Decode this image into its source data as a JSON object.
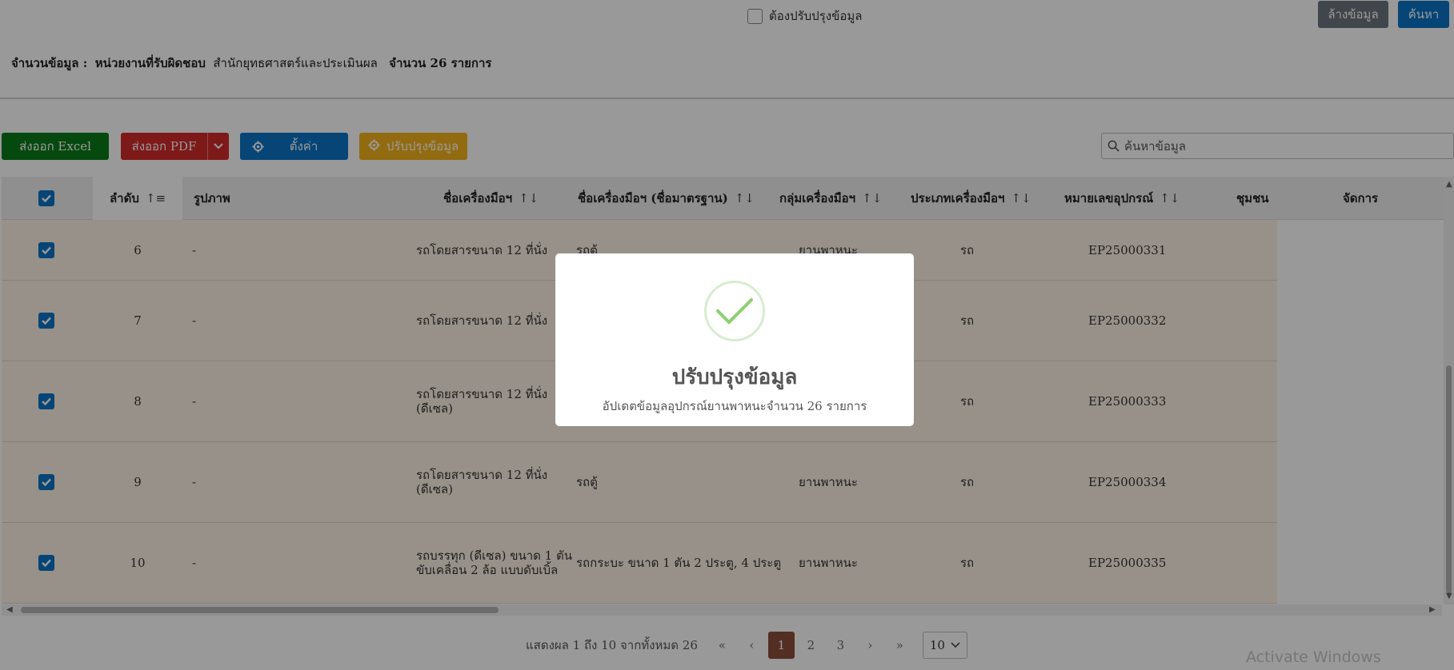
{
  "top": {
    "need_update_label": "ต้องปรับปรุงข้อมูล",
    "clear_label": "ล้างข้อมูล",
    "search_label": "ค้นหา"
  },
  "summary": {
    "prefix": "จำนวนข้อมูล :",
    "unit_label": "หน่วยงานที่รับผิดชอบ",
    "unit_value": "สำนักยุทธศาสตร์และประเมินผล",
    "count": "จำนวน 26 รายการ"
  },
  "toolbar": {
    "excel": "ส่งออก Excel",
    "pdf": "ส่งออก PDF",
    "settings": "ตั้งค่า",
    "update": "ปรับปรุงข้อมูล",
    "search_placeholder": "ค้นหาข้อมูล"
  },
  "table": {
    "headers": {
      "order": "ลำดับ",
      "image": "รูปภาพ",
      "name": "ชื่อเครื่องมือฯ",
      "std_name": "ชื่อเครื่องมือฯ (ชื่อมาตรฐาน)",
      "group": "กลุ่มเครื่องมือฯ",
      "type": "ประเภทเครื่องมือฯ",
      "equip_no": "หมายเลขอุปกรณ์",
      "community": "ชุมชน",
      "manage": "จัดการ"
    },
    "rows": [
      {
        "order": "6",
        "image": "-",
        "name": "รถโดยสารขนาด 12 ที่นั่ง",
        "name2": "",
        "std_name": "รถตู้",
        "group": "ยานพาหนะ",
        "type": "รถ",
        "equip_no": "EP25000331"
      },
      {
        "order": "7",
        "image": "-",
        "name": "รถโดยสารขนาด 12 ที่นั่ง",
        "name2": "",
        "std_name": "",
        "group": "",
        "type": "รถ",
        "equip_no": "EP25000332"
      },
      {
        "order": "8",
        "image": "-",
        "name": "รถโดยสารขนาด 12 ที่นั่ง",
        "name2": "(ดีเซล)",
        "std_name": "",
        "group": "",
        "type": "รถ",
        "equip_no": "EP25000333"
      },
      {
        "order": "9",
        "image": "-",
        "name": "รถโดยสารขนาด 12 ที่นั่ง",
        "name2": "(ดีเซล)",
        "std_name": "รถตู้",
        "group": "ยานพาหนะ",
        "type": "รถ",
        "equip_no": "EP25000334"
      },
      {
        "order": "10",
        "image": "-",
        "name": "รถบรรทุก (ดีเซล) ขนาด 1 ตัน",
        "name2": "ขับเคลื่อน 2 ล้อ แบบดับเบิ้ล",
        "std_name": "รถกระบะ ขนาด 1 ตัน 2 ประตู, 4 ประตู",
        "group": "ยานพาหนะ",
        "type": "รถ",
        "equip_no": "EP25000335"
      }
    ]
  },
  "pagination": {
    "info": "แสดงผล 1 ถึง 10 จากทั้งหมด 26",
    "first": "«",
    "prev": "‹",
    "pages": [
      "1",
      "2",
      "3"
    ],
    "next": "›",
    "last": "»",
    "per_page": "10"
  },
  "watermark": "Activate Windows",
  "modal": {
    "title": "ปรับปรุงข้อมูล",
    "text": "อัปเดตข้อมูลอุปกรณ์ยานพาหนะจำนวน 26 รายการ"
  },
  "colors": {
    "primary": "#0b74c5",
    "excel": "#0a7b1a",
    "pdf": "#d32a2a",
    "update": "#f3b21c",
    "clear": "#6c757d",
    "selected_row": "#fdf2e5",
    "active_page": "#8a4e3a",
    "success": "#8ccf72"
  },
  "icons": {
    "settings": "gear-icon",
    "update": "gear-icon",
    "search": "search-icon",
    "success": "check-circle-icon"
  }
}
